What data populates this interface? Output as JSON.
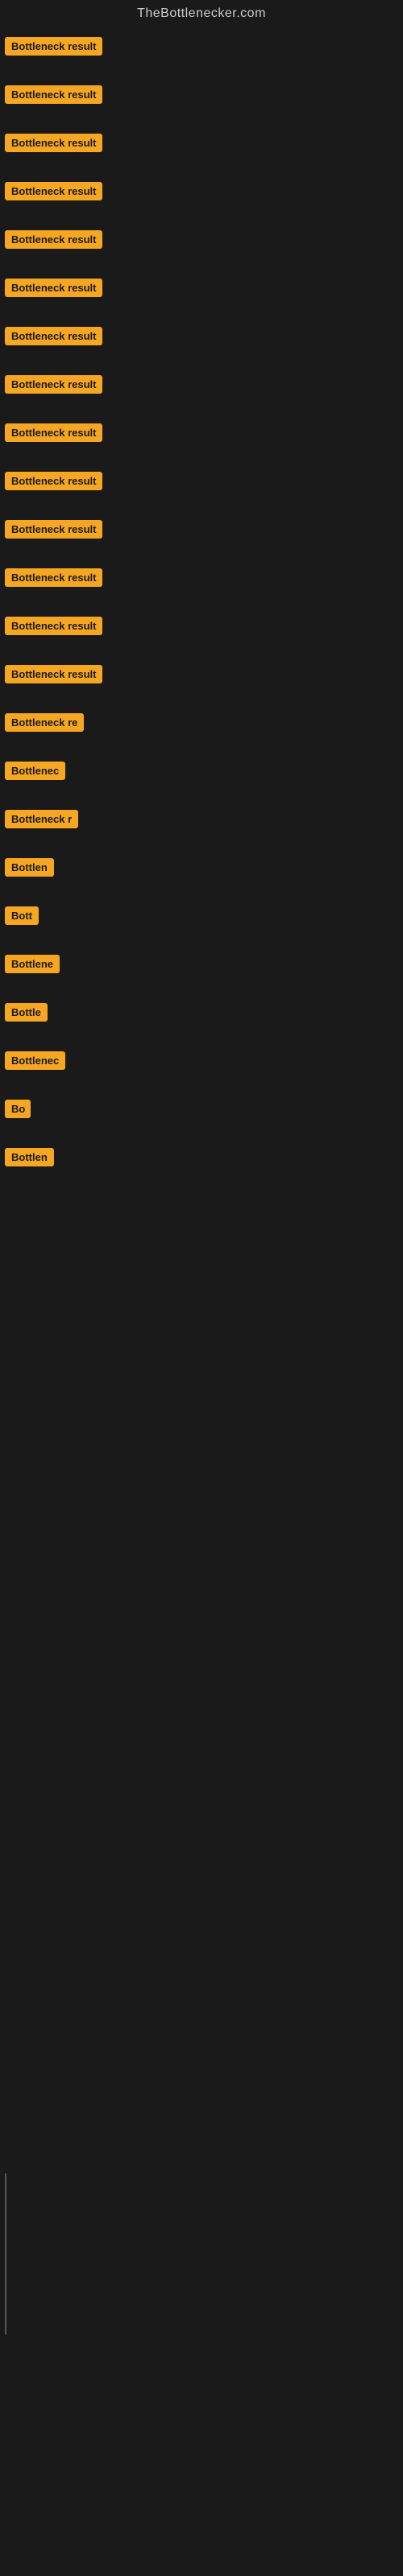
{
  "site": {
    "title": "TheBottlenecker.com"
  },
  "badges": [
    {
      "id": 1,
      "label": "Bottleneck result",
      "width": 130
    },
    {
      "id": 2,
      "label": "Bottleneck result",
      "width": 130
    },
    {
      "id": 3,
      "label": "Bottleneck result",
      "width": 130
    },
    {
      "id": 4,
      "label": "Bottleneck result",
      "width": 130
    },
    {
      "id": 5,
      "label": "Bottleneck result",
      "width": 130
    },
    {
      "id": 6,
      "label": "Bottleneck result",
      "width": 130
    },
    {
      "id": 7,
      "label": "Bottleneck result",
      "width": 130
    },
    {
      "id": 8,
      "label": "Bottleneck result",
      "width": 130
    },
    {
      "id": 9,
      "label": "Bottleneck result",
      "width": 130
    },
    {
      "id": 10,
      "label": "Bottleneck result",
      "width": 130
    },
    {
      "id": 11,
      "label": "Bottleneck result",
      "width": 130
    },
    {
      "id": 12,
      "label": "Bottleneck result",
      "width": 130
    },
    {
      "id": 13,
      "label": "Bottleneck result",
      "width": 130
    },
    {
      "id": 14,
      "label": "Bottleneck result",
      "width": 130
    },
    {
      "id": 15,
      "label": "Bottleneck re",
      "width": 110
    },
    {
      "id": 16,
      "label": "Bottlenec",
      "width": 85
    },
    {
      "id": 17,
      "label": "Bottleneck r",
      "width": 95
    },
    {
      "id": 18,
      "label": "Bottlen",
      "width": 72
    },
    {
      "id": 19,
      "label": "Bott",
      "width": 48
    },
    {
      "id": 20,
      "label": "Bottlene",
      "width": 78
    },
    {
      "id": 21,
      "label": "Bottle",
      "width": 60
    },
    {
      "id": 22,
      "label": "Bottlenec",
      "width": 85
    },
    {
      "id": 23,
      "label": "Bo",
      "width": 32
    },
    {
      "id": 24,
      "label": "Bottlen",
      "width": 72
    }
  ]
}
